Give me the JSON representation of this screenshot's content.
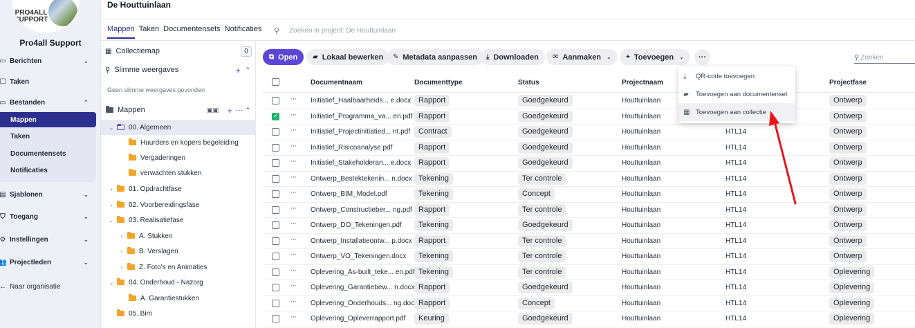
{
  "org": {
    "logo_line1": "PRO4ALL",
    "logo_line2": "SUPPORT",
    "name": "Pro4all Support"
  },
  "sidebar": {
    "items": [
      {
        "label": "Berichten",
        "icon": "chat-icon"
      },
      {
        "label": "Taken",
        "icon": "task-icon"
      },
      {
        "label": "Bestanden",
        "icon": "folder-icon"
      },
      {
        "label": "Sjablonen",
        "icon": "template-icon"
      },
      {
        "label": "Toegang",
        "icon": "shield-icon"
      },
      {
        "label": "Instellingen",
        "icon": "gear-icon"
      },
      {
        "label": "Projectleden",
        "icon": "people-icon"
      },
      {
        "label": "Naar organisatie",
        "icon": "arrow-left-icon"
      }
    ],
    "bestanden_sub": [
      "Mappen",
      "Taken",
      "Documentensets",
      "Notificaties"
    ]
  },
  "header": {
    "title": "De Houttuinlaan"
  },
  "tabs": [
    "Mappen",
    "Taken",
    "Documentensets",
    "Notificaties"
  ],
  "project_search": {
    "placeholder": "Zoeken in project: De Houttuinlaan"
  },
  "folders_panel": {
    "collectiemap": "Collectiemap",
    "collectiemap_count": "0",
    "slimme_weergaves": "Slimme weergaves",
    "slimme_note": "Geen slimme weergaves gevonden",
    "mappen": "Mappen",
    "tree": [
      {
        "label": "00. Algemeen",
        "level": 0,
        "caret": "⌄",
        "selected": true
      },
      {
        "label": "Huurders en kopers begeleiding",
        "level": 1,
        "caret": ""
      },
      {
        "label": "Vergaderingen",
        "level": 1,
        "caret": ""
      },
      {
        "label": "verwachten stukken",
        "level": 1,
        "caret": ""
      },
      {
        "label": "01. Opdrachtfase",
        "level": 0,
        "caret": "›"
      },
      {
        "label": "02. Voorbereidingsfase",
        "level": 0,
        "caret": "›"
      },
      {
        "label": "03. Realisatiefase",
        "level": 0,
        "caret": "⌄"
      },
      {
        "label": "A. Stukken",
        "level": 1,
        "caret": "›"
      },
      {
        "label": "B. Verslagen",
        "level": 1,
        "caret": "›"
      },
      {
        "label": "Z. Foto's en Animaties",
        "level": 1,
        "caret": "›"
      },
      {
        "label": "04. Onderhoud - Nazorg",
        "level": 0,
        "caret": "⌄"
      },
      {
        "label": "A. Garantiestukken",
        "level": 1,
        "caret": ""
      },
      {
        "label": "05. Bim",
        "level": 0,
        "caret": ""
      }
    ]
  },
  "toolbar": {
    "open": "Open",
    "lokaal": "Lokaal bewerken",
    "metadata": "Metadata aanpassen",
    "downloaden": "Downloaden",
    "aanmaken": "Aanmaken",
    "toevoegen": "Toevoegen",
    "more": "···",
    "search_placeholder": "Zoeken"
  },
  "table": {
    "headers": [
      "Documentnaam",
      "Documenttype",
      "Status",
      "Projectnaam",
      "Projectfase"
    ],
    "rows": [
      {
        "name": "Initiatief_Haalbaarheids... e.docx",
        "type": "Rapport",
        "status": "Goedgekeurd",
        "project": "Houttuinlaan",
        "code": "",
        "phase": "Ontwerp",
        "checked": false
      },
      {
        "name": "Initiatief_Programma_va... en.pdf",
        "type": "Rapport",
        "status": "Goedgekeurd",
        "project": "Houttuinlaan",
        "code": "",
        "phase": "Ontwerp",
        "checked": true
      },
      {
        "name": "Initiatief_Projectinitiatied... nt.pdf",
        "type": "Contract",
        "status": "Goedgekeurd",
        "project": "Houttuinlaan",
        "code": "HTL14",
        "phase": "Ontwerp",
        "checked": false
      },
      {
        "name": "Initiatief_Risicoanalyse.pdf",
        "type": "Rapport",
        "status": "Goedgekeurd",
        "project": "Houttuinlaan",
        "code": "HTL14",
        "phase": "Ontwerp",
        "checked": false
      },
      {
        "name": "Initiatief_Stakeholderan... e.docx",
        "type": "Rapport",
        "status": "Goedgekeurd",
        "project": "Houttuinlaan",
        "code": "HTL14",
        "phase": "Ontwerp",
        "checked": false
      },
      {
        "name": "Ontwerp_Bestektekenin... n.docx",
        "type": "Tekening",
        "status": "Ter controle",
        "project": "Houttuinlaan",
        "code": "HTL14",
        "phase": "Ontwerp",
        "checked": false
      },
      {
        "name": "Ontwerp_BIM_Model.pdf",
        "type": "Tekening",
        "status": "Concept",
        "project": "Houttuinlaan",
        "code": "HTL14",
        "phase": "Ontwerp",
        "checked": false
      },
      {
        "name": "Ontwerp_Constructieber... ng.pdf",
        "type": "Rapport",
        "status": "Ter controle",
        "project": "Houttuinlaan",
        "code": "HTL14",
        "phase": "Ontwerp",
        "checked": false
      },
      {
        "name": "Ontwerp_DO_Tekeningen.pdf",
        "type": "Tekening",
        "status": "Goedgekeurd",
        "project": "Houttuinlaan",
        "code": "HTL14",
        "phase": "Ontwerp",
        "checked": false
      },
      {
        "name": "Ontwerp_Installatieontw... p.docx",
        "type": "Rapport",
        "status": "Ter controle",
        "project": "Houttuinlaan",
        "code": "HTL14",
        "phase": "Ontwerp",
        "checked": false
      },
      {
        "name": "Ontwerp_VO_Tekeningen.docx",
        "type": "Tekening",
        "status": "Ter controle",
        "project": "Houttuinlaan",
        "code": "HTL14",
        "phase": "Ontwerp",
        "checked": false
      },
      {
        "name": "Oplevering_As-built_teke... en.pdf",
        "type": "Tekening",
        "status": "Ter controle",
        "project": "Houttuinlaan",
        "code": "HTL14",
        "phase": "Oplevering",
        "checked": false
      },
      {
        "name": "Oplevering_Garantiebew... n.docx",
        "type": "Rapport",
        "status": "Goedgekeurd",
        "project": "Houttuinlaan",
        "code": "HTL14",
        "phase": "Oplevering",
        "checked": false
      },
      {
        "name": "Oplevering_Onderhouds... ng.docx",
        "type": "Rapport",
        "status": "Concept",
        "project": "Houttuinlaan",
        "code": "HTL14",
        "phase": "Oplevering",
        "checked": false
      },
      {
        "name": "Oplevering_Opleverrapport.pdf",
        "type": "Keuring",
        "status": "Goedgekeurd",
        "project": "Houttuinlaan",
        "code": "HTL14",
        "phase": "Oplevering",
        "checked": false
      }
    ]
  },
  "menu": {
    "items": [
      {
        "label": "QR-code toevoegen",
        "icon": "qr-download-icon"
      },
      {
        "label": "Toevoegen aan documentenset",
        "icon": "document-set-icon"
      },
      {
        "label": "Toevoegen aan collectie",
        "icon": "collection-icon"
      }
    ]
  },
  "colors": {
    "accent": "#2d2f8f",
    "primary_button": "#5b46d6",
    "annotation_arrow": "#e8161b"
  }
}
